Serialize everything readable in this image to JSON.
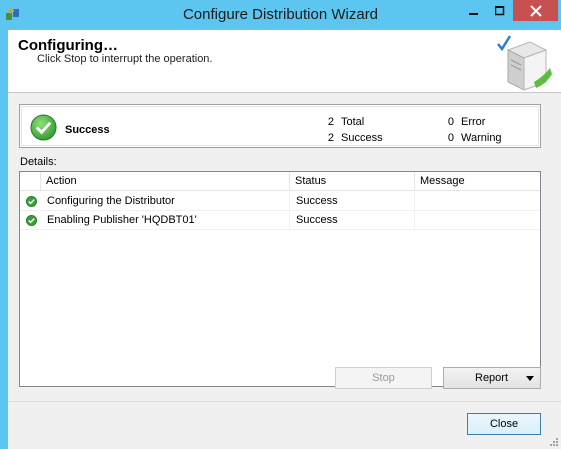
{
  "window": {
    "title": "Configure Distribution Wizard",
    "app_icon": "wizard-icon",
    "controls": [
      "minimize-icon",
      "maximize-icon",
      "close-icon"
    ]
  },
  "header": {
    "title": "Configuring…",
    "subtitle": "Click Stop to interrupt the operation.",
    "art_icon": "server-wizard-icon"
  },
  "summary": {
    "status": "Success",
    "status_icon": "success-check-icon",
    "total_count": "2",
    "total_label": "Total",
    "success_count": "2",
    "success_label": "Success",
    "error_count": "0",
    "error_label": "Error",
    "warning_count": "0",
    "warning_label": "Warning"
  },
  "details": {
    "label": "Details:",
    "columns": [
      "Action",
      "Status",
      "Message"
    ],
    "rows": [
      {
        "icon": "success-check-icon",
        "action": "Configuring the Distributor",
        "status": "Success",
        "message": ""
      },
      {
        "icon": "success-check-icon",
        "action": "Enabling Publisher 'HQDBT01'",
        "status": "Success",
        "message": ""
      }
    ]
  },
  "buttons": {
    "stop": "Stop",
    "report": "Report",
    "close": "Close"
  },
  "colors": {
    "titlebar": "#5cc6f0",
    "close_button": "#c75050",
    "success_green": "#3aa13a"
  }
}
